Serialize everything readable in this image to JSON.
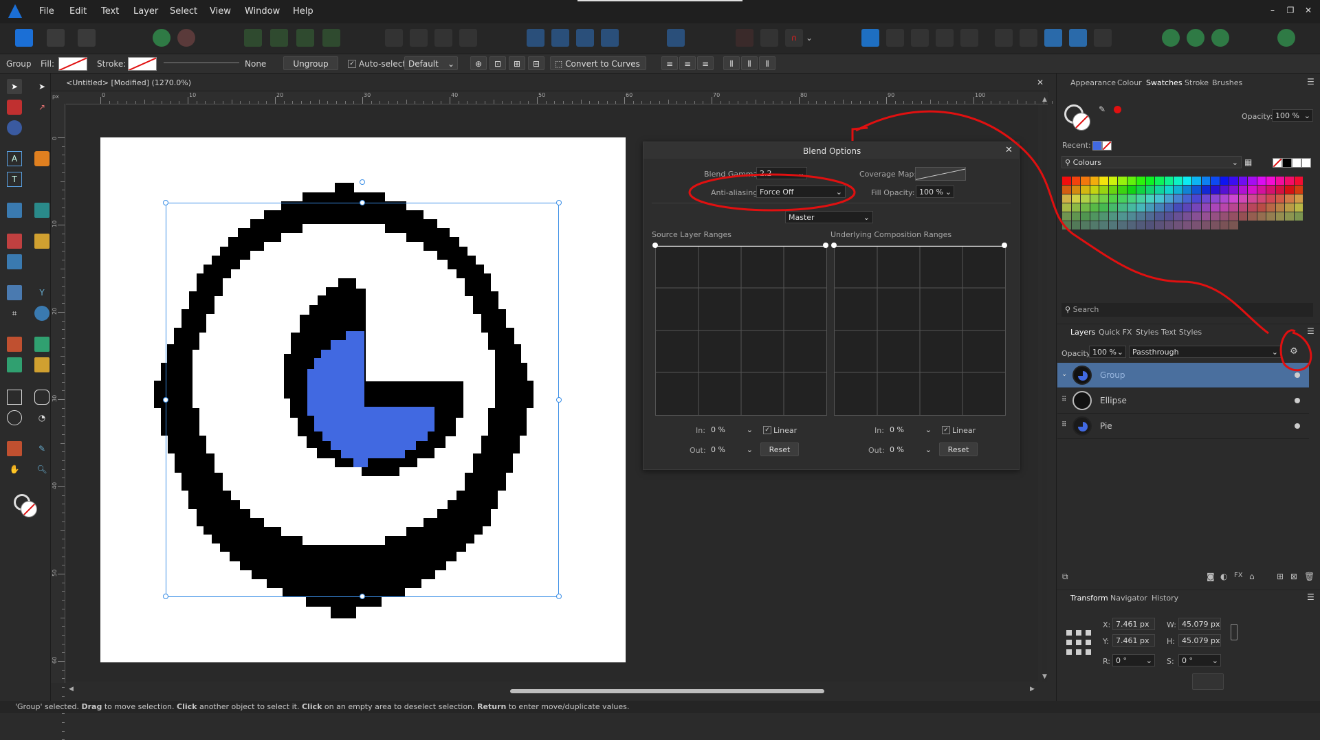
{
  "menubar": {
    "items": [
      "File",
      "Edit",
      "Text",
      "Layer",
      "Select",
      "View",
      "Window",
      "Help"
    ]
  },
  "context_toolbar": {
    "group_label": "Group",
    "fill_label": "Fill:",
    "stroke_label": "Stroke:",
    "stroke_width_value": "None",
    "ungroup_label": "Ungroup",
    "autoselect_label": "Auto-select:",
    "autoselect_value": "Default",
    "convert_label": "Convert to Curves"
  },
  "document": {
    "tab_title": "<Untitled> [Modified] (1270.0%)",
    "ruler_unit": "px",
    "h_ticks": [
      "0",
      "10",
      "20",
      "30",
      "40",
      "50",
      "60",
      "70",
      "80",
      "90",
      "100"
    ],
    "v_ticks": [
      "0",
      "10",
      "20",
      "30",
      "40",
      "50",
      "60"
    ]
  },
  "blend_options": {
    "title": "Blend Options",
    "blend_gamma_label": "Blend Gamma:",
    "blend_gamma_value": "2.2",
    "coverage_map_label": "Coverage Map:",
    "antialiasing_label": "Anti-aliasing:",
    "antialiasing_value": "Force Off",
    "fill_opacity_label": "Fill Opacity:",
    "fill_opacity_value": "100 %",
    "channel_value": "Master",
    "source_ranges_label": "Source Layer Ranges",
    "underlying_ranges_label": "Underlying Composition Ranges",
    "in_label": "In:",
    "out_label": "Out:",
    "source_in_value": "0 %",
    "source_out_value": "0 %",
    "under_in_value": "0 %",
    "under_out_value": "0 %",
    "linear_label": "Linear",
    "reset_label": "Reset"
  },
  "swatches_panel": {
    "tabs": [
      "Appearance",
      "Colour",
      "Swatches",
      "Stroke",
      "Brushes"
    ],
    "active_tab": "Swatches",
    "opacity_label": "Opacity:",
    "opacity_value": "100 %",
    "recent_label": "Recent:",
    "palette_name": "Colours",
    "search_placeholder": "Search"
  },
  "layers_panel": {
    "tabs": [
      "Layers",
      "Quick FX",
      "Styles",
      "Text Styles"
    ],
    "active_tab": "Layers",
    "opacity_label": "Opacity:",
    "opacity_value": "100 %",
    "blend_mode": "Passthrough",
    "layers": [
      {
        "name": "Group",
        "selected": true
      },
      {
        "name": "Ellipse",
        "selected": false
      },
      {
        "name": "Pie",
        "selected": false
      }
    ]
  },
  "transform_panel": {
    "tabs": [
      "Transform",
      "Navigator",
      "History"
    ],
    "active_tab": "Transform",
    "x_label": "X:",
    "x_value": "7.461 px",
    "y_label": "Y:",
    "y_value": "7.461 px",
    "w_label": "W:",
    "w_value": "45.079 px",
    "h_label": "H:",
    "h_value": "45.079 px",
    "r_label": "R:",
    "r_value": "0 °",
    "s_label": "S:",
    "s_value": "0 °"
  },
  "status": {
    "part1": "'Group' selected. ",
    "drag": "Drag",
    "part2": " to move selection. ",
    "click1": "Click",
    "part3": " another object to select it. ",
    "click2": "Click",
    "part4": " on an empty area to deselect selection. ",
    "ret": "Return",
    "part5": " to enter move/duplicate values."
  },
  "colors": {
    "accent": "#4c7fd1",
    "pie_blue": "#4169e1",
    "annotation_red": "#e01010"
  }
}
